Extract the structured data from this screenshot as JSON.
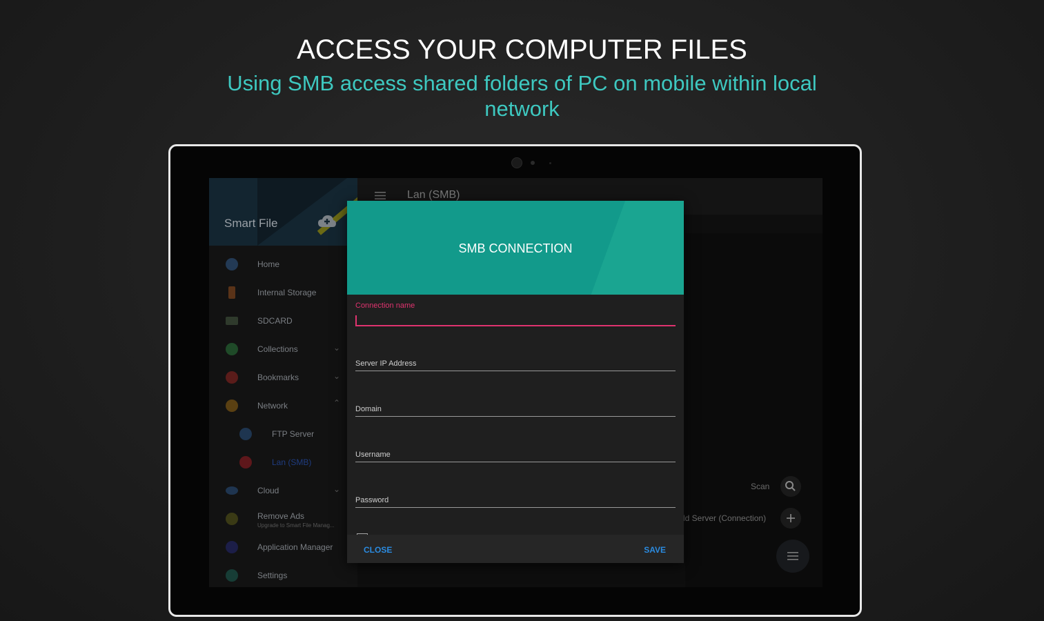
{
  "promo": {
    "headline": "ACCESS YOUR COMPUTER FILES",
    "subline": "Using SMB access shared folders of PC on mobile within local network"
  },
  "drawer": {
    "app_name": "Smart File",
    "items": [
      {
        "label": "Home",
        "icon": "home-icon",
        "color": "#3b6fb0"
      },
      {
        "label": "Internal Storage",
        "icon": "phone-storage-icon",
        "color": "#c9682a"
      },
      {
        "label": "SDCARD",
        "icon": "sdcard-icon",
        "color": "#5aa04a"
      },
      {
        "label": "Collections",
        "icon": "collections-icon",
        "color": "#3aa049"
      },
      {
        "label": "Bookmarks",
        "icon": "bookmark-icon",
        "color": "#c33b32"
      },
      {
        "label": "Network",
        "icon": "network-icon",
        "color": "#c58a1a"
      },
      {
        "label": "FTP Server",
        "icon": "globe-icon",
        "color": "#4a7fb0"
      },
      {
        "label": "Lan (SMB)",
        "icon": "lan-icon",
        "color": "#d0343b"
      },
      {
        "label": "Cloud",
        "icon": "cloud-icon",
        "color": "#3b6fb0"
      },
      {
        "label": "Remove Ads",
        "sublabel": "Upgrade to Smart File Manag...",
        "icon": "crown-icon",
        "color": "#c9a21a"
      },
      {
        "label": "Application Manager",
        "icon": "android-icon",
        "color": "#3a3fa0"
      },
      {
        "label": "Settings",
        "icon": "settings-icon",
        "color": "#2b8f7a"
      }
    ]
  },
  "main": {
    "title": "Lan (SMB)",
    "scan_label": "Scan",
    "add_server_label": "dd Server (Connection)"
  },
  "dialog": {
    "title": "SMB CONNECTION",
    "fields": {
      "connection_name": "Connection name",
      "server_ip": "Server IP Address",
      "domain": "Domain",
      "username": "Username",
      "password": "Password"
    },
    "close_label": "CLOSE",
    "save_label": "SAVE"
  },
  "colors": {
    "accent_teal": "#129a8b",
    "subline_teal": "#3ec8c0",
    "focus_pink": "#e0336f",
    "button_blue": "#2b8be0"
  }
}
